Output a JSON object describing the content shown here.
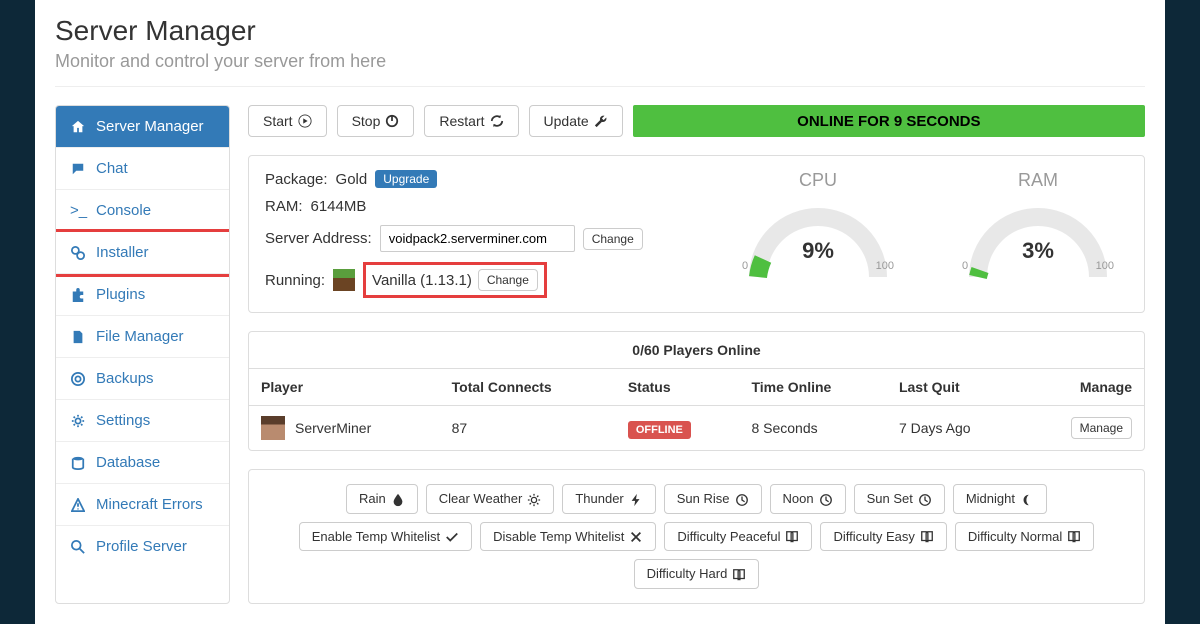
{
  "header": {
    "title": "Server Manager",
    "subtitle": "Monitor and control your server from here"
  },
  "sidebar": {
    "items": [
      {
        "label": "Server Manager",
        "icon": "home"
      },
      {
        "label": "Chat",
        "icon": "chat"
      },
      {
        "label": "Console",
        "icon": "terminal"
      },
      {
        "label": "Installer",
        "icon": "gears"
      },
      {
        "label": "Plugins",
        "icon": "puzzle"
      },
      {
        "label": "File Manager",
        "icon": "file"
      },
      {
        "label": "Backups",
        "icon": "life-ring"
      },
      {
        "label": "Settings",
        "icon": "cog"
      },
      {
        "label": "Database",
        "icon": "db"
      },
      {
        "label": "Minecraft Errors",
        "icon": "warn"
      },
      {
        "label": "Profile Server",
        "icon": "search"
      }
    ]
  },
  "toolbar": {
    "start": "Start",
    "stop": "Stop",
    "restart": "Restart",
    "update": "Update",
    "status": "ONLINE FOR 9 SECONDS"
  },
  "info": {
    "package_label": "Package:",
    "package_value": "Gold",
    "upgrade": "Upgrade",
    "ram_label": "RAM:",
    "ram_value": "6144MB",
    "addr_label": "Server Address:",
    "addr_value": "voidpack2.serverminer.com",
    "change": "Change",
    "running_label": "Running:",
    "running_value": "Vanilla (1.13.1)"
  },
  "gauges": {
    "cpu": {
      "title": "CPU",
      "value": "9%",
      "pct": 9,
      "min": "0",
      "max": "100"
    },
    "ram": {
      "title": "RAM",
      "value": "3%",
      "pct": 3,
      "min": "0",
      "max": "100"
    }
  },
  "players": {
    "header": "0/60 Players Online",
    "columns": {
      "player": "Player",
      "connects": "Total Connects",
      "status": "Status",
      "time": "Time Online",
      "quit": "Last Quit",
      "manage": "Manage"
    },
    "rows": [
      {
        "name": "ServerMiner",
        "connects": "87",
        "status": "OFFLINE",
        "time": "8 Seconds",
        "quit": "7 Days Ago",
        "manage": "Manage"
      }
    ]
  },
  "actions": [
    "Rain",
    "Clear Weather",
    "Thunder",
    "Sun Rise",
    "Noon",
    "Sun Set",
    "Midnight",
    "Enable Temp Whitelist",
    "Disable Temp Whitelist",
    "Difficulty Peaceful",
    "Difficulty Easy",
    "Difficulty Normal",
    "Difficulty Hard"
  ],
  "action_icons": [
    "drop",
    "sun",
    "bolt",
    "clock",
    "clock",
    "clock",
    "moon",
    "check",
    "x",
    "book",
    "book",
    "book",
    "book"
  ]
}
